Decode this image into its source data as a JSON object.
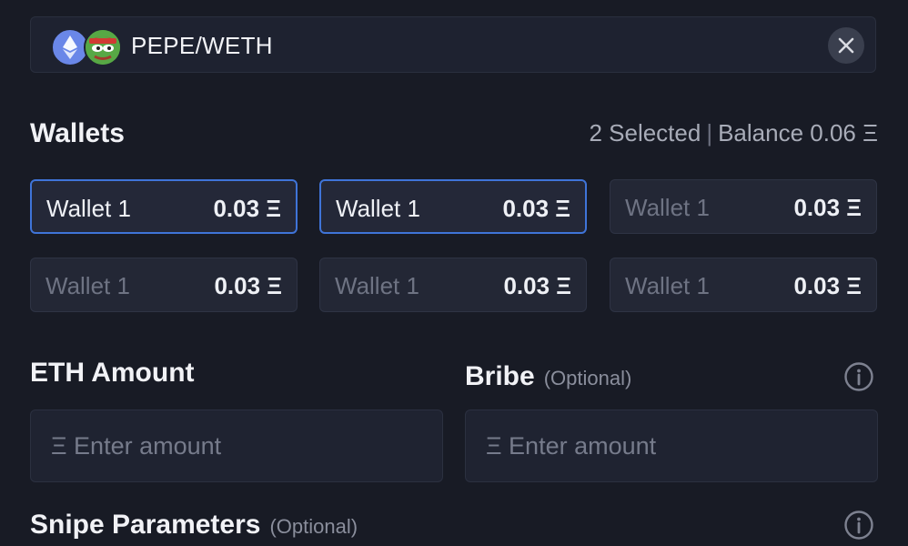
{
  "pair": {
    "label": "PEPE/WETH",
    "base_icon": "pepe-token-icon",
    "quote_icon": "ethereum-icon",
    "close_icon": "close-icon"
  },
  "wallets": {
    "title": "Wallets",
    "selected_text": "2 Selected",
    "separator": "|",
    "balance_text": "Balance 0.06 Ξ",
    "items": [
      {
        "name": "Wallet 1",
        "balance": "0.03 Ξ",
        "selected": true
      },
      {
        "name": "Wallet 1",
        "balance": "0.03 Ξ",
        "selected": true
      },
      {
        "name": "Wallet 1",
        "balance": "0.03 Ξ",
        "selected": false
      },
      {
        "name": "Wallet 1",
        "balance": "0.03 Ξ",
        "selected": false
      },
      {
        "name": "Wallet 1",
        "balance": "0.03 Ξ",
        "selected": false
      },
      {
        "name": "Wallet 1",
        "balance": "0.03 Ξ",
        "selected": false
      }
    ]
  },
  "eth_amount": {
    "label": "ETH Amount",
    "placeholder": "Ξ Enter amount"
  },
  "bribe": {
    "label": "Bribe",
    "optional": "(Optional)",
    "placeholder": "Ξ Enter amount",
    "info_icon": "info-icon"
  },
  "snipe": {
    "label": "Snipe Parameters",
    "optional": "(Optional)",
    "info_icon": "info-icon"
  },
  "colors": {
    "background": "#181b25",
    "accent": "#3f74d8",
    "card": "#232735"
  }
}
